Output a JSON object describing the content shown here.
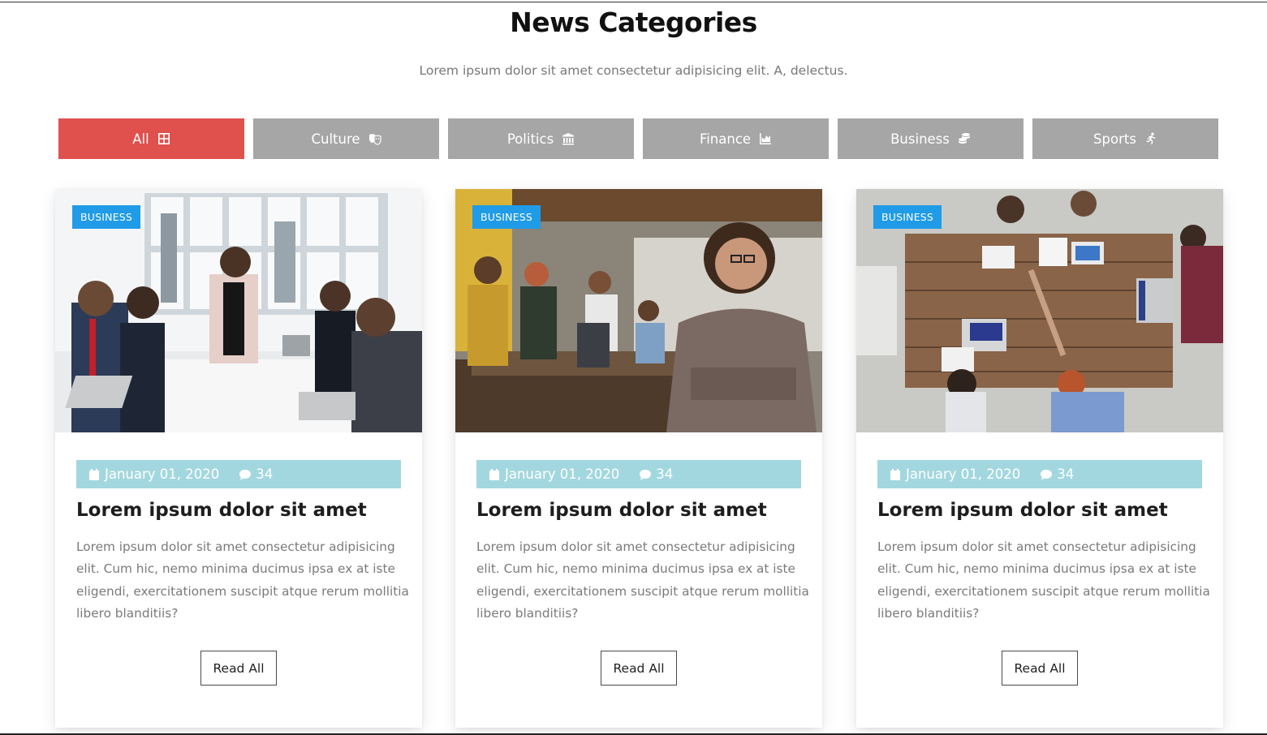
{
  "header": {
    "title": "News Categories",
    "subtitle": "Lorem ipsum dolor sit amet consectetur adipisicing elit. A, delectus."
  },
  "tabs": [
    {
      "label": "All",
      "icon": "grid-icon",
      "active": true
    },
    {
      "label": "Culture",
      "icon": "theater-masks-icon",
      "active": false
    },
    {
      "label": "Politics",
      "icon": "landmark-icon",
      "active": false
    },
    {
      "label": "Finance",
      "icon": "area-chart-icon",
      "active": false
    },
    {
      "label": "Business",
      "icon": "coins-icon",
      "active": false
    },
    {
      "label": "Sports",
      "icon": "running-icon",
      "active": false
    }
  ],
  "colors": {
    "active_tab": "#e0504d",
    "inactive_tab": "#a6a6a6",
    "badge": "#1f9be8",
    "meta_bar": "#a3d7df"
  },
  "cards": [
    {
      "badge": "BUSINESS",
      "image": "team-meeting-photo",
      "date": "January 01, 2020",
      "comments": "34",
      "title": "Lorem ipsum dolor sit amet",
      "text": "Lorem ipsum dolor sit amet consectetur adipisicing elit. Cum hic, nemo minima ducimus ipsa ex at iste eligendi, exercitationem suscipit atque rerum mollitia libero blanditiis?",
      "button": "Read All"
    },
    {
      "badge": "BUSINESS",
      "image": "office-woman-photo",
      "date": "January 01, 2020",
      "comments": "34",
      "title": "Lorem ipsum dolor sit amet",
      "text": "Lorem ipsum dolor sit amet consectetur adipisicing elit. Cum hic, nemo minima ducimus ipsa ex at iste eligendi, exercitationem suscipit atque rerum mollitia libero blanditiis?",
      "button": "Read All"
    },
    {
      "badge": "BUSINESS",
      "image": "table-top-view-photo",
      "date": "January 01, 2020",
      "comments": "34",
      "title": "Lorem ipsum dolor sit amet",
      "text": "Lorem ipsum dolor sit amet consectetur adipisicing elit. Cum hic, nemo minima ducimus ipsa ex at iste eligendi, exercitationem suscipit atque rerum mollitia libero blanditiis?",
      "button": "Read All"
    }
  ]
}
